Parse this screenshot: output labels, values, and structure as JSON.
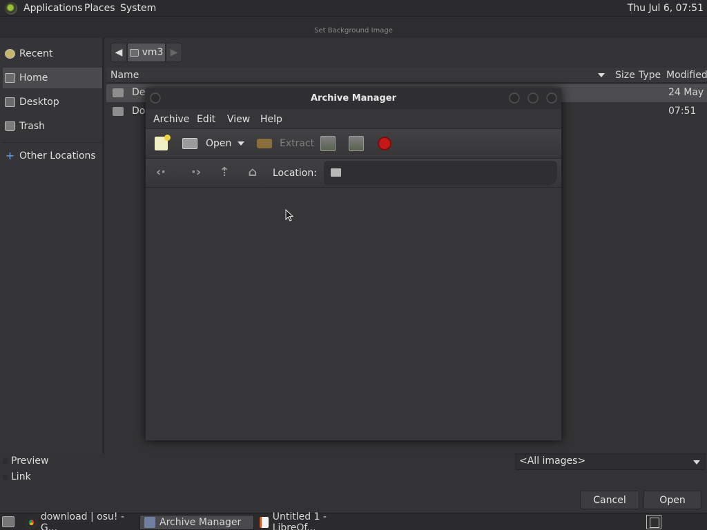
{
  "top_panel": {
    "menus": [
      "Applications",
      "Places",
      "System"
    ],
    "clock": "Thu Jul  6, 07:51"
  },
  "dialog": {
    "title": "Set Background Image",
    "sidebar": [
      "Recent",
      "Home",
      "Desktop",
      "Trash",
      "Other Locations"
    ],
    "selected_sidebar": "Home",
    "path": "vm3",
    "columns": [
      "Name",
      "Size",
      "Type",
      "Modified"
    ],
    "files": [
      {
        "name": "Des",
        "modified": "24 May",
        "selected": true
      },
      {
        "name": "Do",
        "modified": "07:51",
        "selected": false
      }
    ],
    "checks": [
      "Preview",
      "Link"
    ],
    "filter": "<All images>",
    "cancel_label": "Cancel",
    "open_label": "Open"
  },
  "archive": {
    "title": "Archive Manager",
    "menus": [
      "Archive",
      "Edit",
      "View",
      "Help"
    ],
    "toolbar": {
      "open": "Open",
      "extract": "Extract"
    },
    "location_label": "Location:"
  },
  "taskbar": {
    "tasks": [
      "download | osu! - G...",
      "Archive Manager",
      "Untitled 1 - LibreOf..."
    ]
  }
}
